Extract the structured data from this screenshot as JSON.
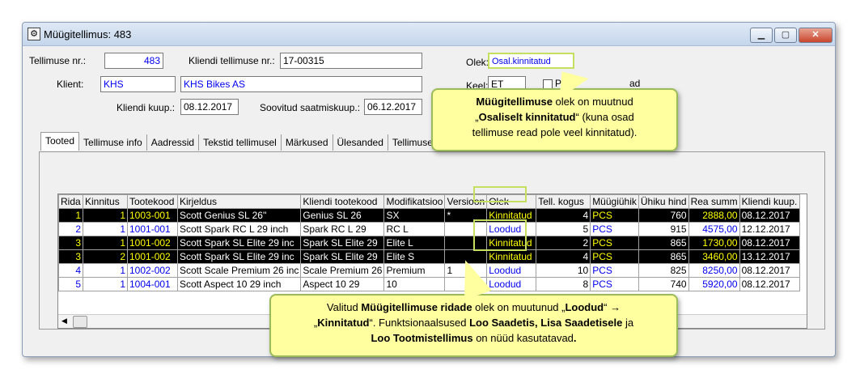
{
  "window": {
    "title": "Müügitellimus: 483"
  },
  "header": {
    "order_no_label": "Tellimuse nr.:",
    "order_no": "483",
    "client_order_label": "Kliendi tellimuse nr.:",
    "client_order": "17-00315",
    "client_label": "Klient:",
    "client_code": "KHS",
    "client_name": "KHS Bikes AS",
    "client_date_label": "Kliendi kuup.:",
    "client_date": "08.12.2017",
    "delivery_label": "Soovitud saatmiskuup.:",
    "delivery_date": "06.12.2017",
    "status_label": "Olek:",
    "status": "Osal.kinnitatud",
    "lang_label": "Keel:",
    "lang": "ET",
    "checkbox_label_left": "Pei",
    "checkbox_label_right": "ad"
  },
  "tabs": [
    "Tooted",
    "Tellimuse info",
    "Aadressid",
    "Tekstid tellimusel",
    "Märkused",
    "Ülesanded",
    "Tellimuse"
  ],
  "grid": {
    "columns": [
      "Rida",
      "Kinnitus",
      "Tootekood",
      "Kirjeldus",
      "Kliendi tootekood",
      "Modifikatsioo",
      "Versioon",
      "Olek",
      "Tell. kogus",
      "Müügiühik",
      "Ühiku hind",
      "Rea summ",
      "Kliendi kuup."
    ],
    "rows": [
      {
        "rida": "1",
        "kinnitus": "1",
        "kood": "1003-001",
        "kirjeldus": "Scott Genius SL 26''",
        "kliendi_kood": "Genius SL 26",
        "mod": "SX",
        "versioon": "*",
        "olek": "Kinnitatud",
        "kogus": "4",
        "yhik": "PCS",
        "hind": "760",
        "summa": "2888,00",
        "kuup": "08.12.2017",
        "selected": true
      },
      {
        "rida": "2",
        "kinnitus": "1",
        "kood": "1001-001",
        "kirjeldus": "Scott Spark RC L 29 inch",
        "kliendi_kood": "Spark RC L 29",
        "mod": "RC L",
        "versioon": "",
        "olek": "Loodud",
        "kogus": "5",
        "yhik": "PCS",
        "hind": "915",
        "summa": "4575,00",
        "kuup": "12.12.2017",
        "selected": false
      },
      {
        "rida": "3",
        "kinnitus": "1",
        "kood": "1001-002",
        "kirjeldus": "Scott Spark SL Elite 29 inc",
        "kliendi_kood": "Spark SL Elite 29",
        "mod": "Elite L",
        "versioon": "",
        "olek": "Kinnitatud",
        "kogus": "2",
        "yhik": "PCS",
        "hind": "865",
        "summa": "1730,00",
        "kuup": "08.12.2017",
        "selected": true
      },
      {
        "rida": "3",
        "kinnitus": "2",
        "kood": "1001-002",
        "kirjeldus": "Scott Spark SL Elite 29 inc",
        "kliendi_kood": "Spark SL Elite 29",
        "mod": "Elite S",
        "versioon": "",
        "olek": "Kinnitatud",
        "kogus": "4",
        "yhik": "PCS",
        "hind": "865",
        "summa": "3460,00",
        "kuup": "13.12.2017",
        "selected": true
      },
      {
        "rida": "4",
        "kinnitus": "1",
        "kood": "1002-002",
        "kirjeldus": "Scott Scale Premium 26 inc",
        "kliendi_kood": "Scale Premium 26",
        "mod": "Premium",
        "versioon": "1",
        "olek": "Loodud",
        "kogus": "10",
        "yhik": "PCS",
        "hind": "825",
        "summa": "8250,00",
        "kuup": "08.12.2017",
        "selected": false
      },
      {
        "rida": "5",
        "kinnitus": "1",
        "kood": "1004-001",
        "kirjeldus": "Scott Aspect 10 29 inch",
        "kliendi_kood": "Aspect 10 29",
        "mod": "10",
        "versioon": "",
        "olek": "Loodud",
        "kogus": "8",
        "yhik": "PCS",
        "hind": "740",
        "summa": "5920,00",
        "kuup": "08.12.2017",
        "selected": false
      }
    ]
  },
  "callouts": {
    "top_line1_bold": "Müügitellimuse",
    "top_line1_rest": " olek on muutnud",
    "top_line2_pre": "„",
    "top_line2_bold": "Osaliselt kinnitatud",
    "top_line2_rest": "“ (kuna osad",
    "top_line3": "tellimuse read pole veel kinnitatud).",
    "bottom_line1_pre": "Valitud ",
    "bottom_line1_bold": "Müügitellimuse ridade",
    "bottom_line1_mid": " olek on muutunud „",
    "bottom_line1_bold2": "Loodud",
    "bottom_line1_end": "“ →",
    "bottom_line2_pre": "„",
    "bottom_line2_bold": "Kinnitatud",
    "bottom_line2_mid": "“.  Funktsionaalsused ",
    "bottom_line2_bold2": "Loo Saadetis, Lisa Saadetisele",
    "bottom_line2_end": " ja",
    "bottom_line3_bold": "Loo Tootmistellimus",
    "bottom_line3_mid": " on nüüd kasutatavad",
    "bottom_line3_end": "."
  },
  "colors": {
    "highlight": "#c5e060",
    "callout_bg": "#ffffa0",
    "selected_text": "#ffff00",
    "link_blue": "#0000ee"
  }
}
